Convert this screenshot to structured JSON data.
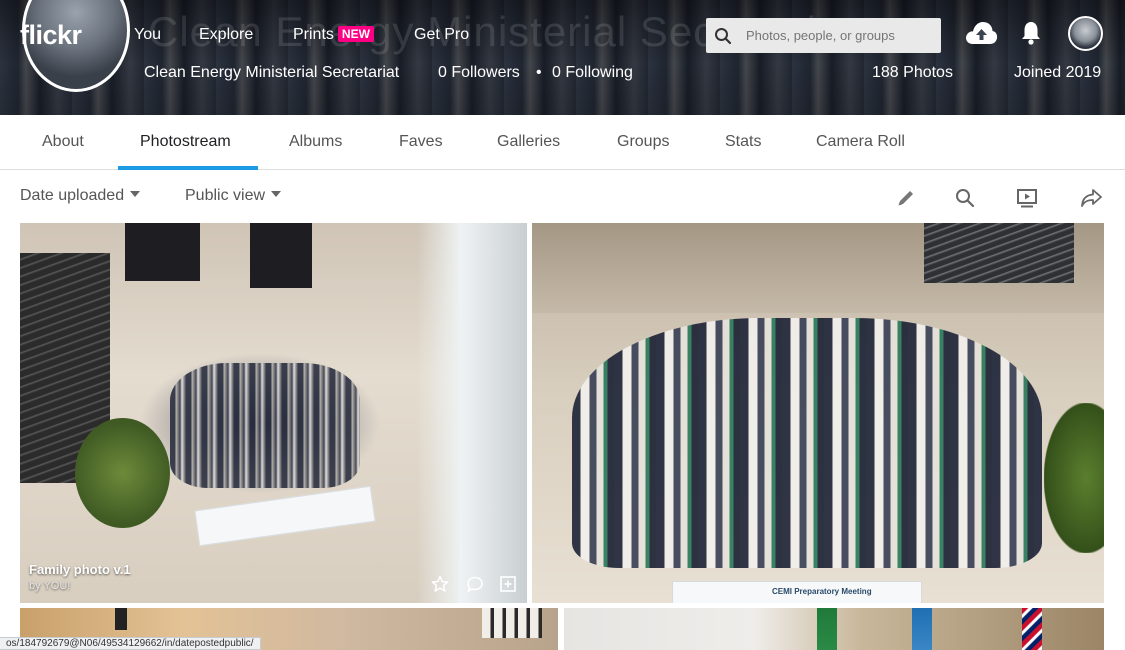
{
  "header": {
    "logo": "flickr",
    "ghost_title": "Clean Energy Ministerial Secretariat",
    "nav": [
      {
        "label": "You"
      },
      {
        "label": "Explore"
      },
      {
        "label": "Prints",
        "badge": "NEW"
      },
      {
        "label": "Get Pro"
      }
    ],
    "search_placeholder": "Photos, people, or groups",
    "icons": [
      "search-icon",
      "upload-cloud-icon",
      "bell-icon",
      "avatar"
    ]
  },
  "profile": {
    "name": "Clean Energy Ministerial Secretariat",
    "followers": "0 Followers",
    "separator": "•",
    "following": "0 Following",
    "photos": "188 Photos",
    "joined": "Joined 2019"
  },
  "tabs": [
    {
      "label": "About"
    },
    {
      "label": "Photostream",
      "active": true
    },
    {
      "label": "Albums"
    },
    {
      "label": "Faves"
    },
    {
      "label": "Galleries"
    },
    {
      "label": "Groups"
    },
    {
      "label": "Stats"
    },
    {
      "label": "Camera Roll"
    }
  ],
  "toolbar": {
    "sort_label": "Date uploaded",
    "view_label": "Public view",
    "icons": [
      "edit-pencil-icon",
      "search-icon",
      "slideshow-icon",
      "share-icon"
    ]
  },
  "photos": [
    {
      "title": "Family photo v.1",
      "by": "by YOU!",
      "actions": [
        "star-icon",
        "comment-icon",
        "add-to-gallery-icon"
      ]
    },
    {
      "banner_text": "CEMI Preparatory Meeting"
    },
    {},
    {}
  ],
  "status_url": "os/184792679@N06/49534129662/in/datepostedpublic/",
  "colors": {
    "accent_blue": "#1c9be5",
    "new_badge": "#ff0084"
  }
}
